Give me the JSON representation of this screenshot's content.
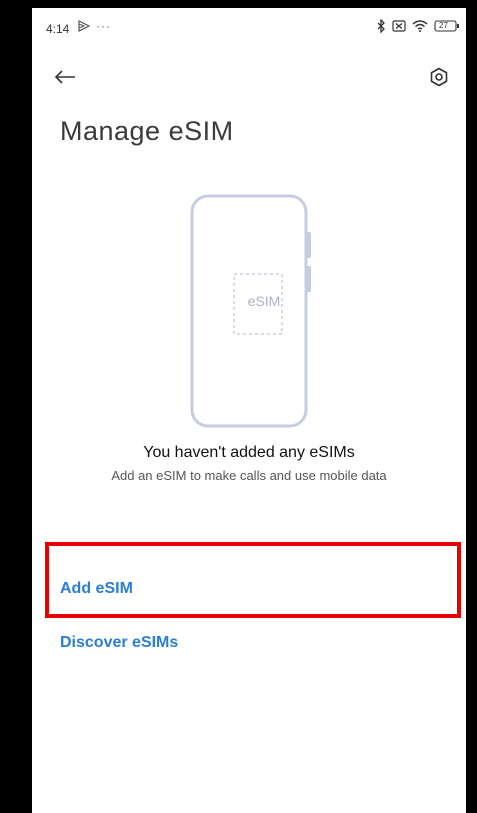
{
  "status_bar": {
    "time": "4:14",
    "cast_icon": "cast-icon",
    "more": "···",
    "battery": "27",
    "icons": [
      "bluetooth-icon",
      "sim-off-icon",
      "wifi-icon",
      "battery-icon"
    ]
  },
  "header": {
    "back_icon": "back-arrow-icon",
    "settings_icon": "settings-icon",
    "title": "Manage eSIM"
  },
  "illustration": {
    "label": "eSIM",
    "icon": "phone-illustration"
  },
  "empty_state": {
    "title": "You haven't added any eSIMs",
    "subtitle": "Add an eSIM to make calls and use mobile data"
  },
  "actions": {
    "add_esim": "Add eSIM",
    "discover_esims": "Discover eSIMs"
  },
  "colors": {
    "accent": "#2a7fd4",
    "highlight": "#e60000",
    "illustration_stroke": "#c5cde0"
  }
}
